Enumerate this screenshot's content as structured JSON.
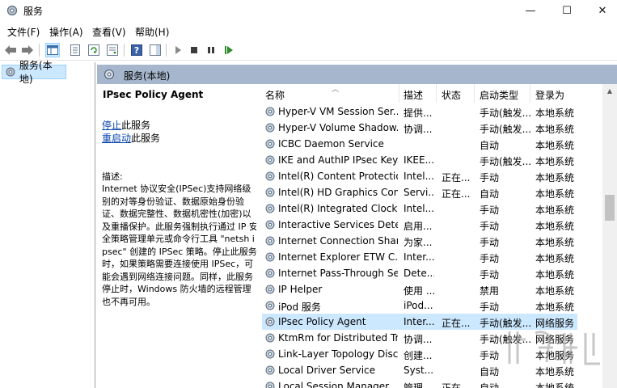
{
  "window": {
    "title": "服务",
    "minimize": "—",
    "maximize": "☐",
    "close": "✕"
  },
  "menu": [
    {
      "label": "文件(F)"
    },
    {
      "label": "操作(A)"
    },
    {
      "label": "查看(V)"
    },
    {
      "label": "帮助(H)"
    }
  ],
  "toolbar": {
    "icons": [
      "back-arrow-icon",
      "forward-arrow-icon",
      "console-tree-icon",
      "properties-icon",
      "refresh-icon",
      "export-list-icon",
      "help-icon",
      "show-hide-pane-icon",
      "play-icon",
      "stop-icon",
      "pause-icon",
      "restart-icon"
    ]
  },
  "tree": {
    "item_label": "服务(本地)"
  },
  "pane": {
    "header_label": "服务(本地)"
  },
  "description": {
    "service_name": "IPsec Policy Agent",
    "stop_link": "停止",
    "stop_suffix": "此服务",
    "restart_link": "重启动",
    "restart_suffix": "此服务",
    "desc_label": "描述:",
    "desc_body": "Internet 协议安全(IPSec)支持网络级别的对等身份验证、数据原始身份验证、数据完整性、数据机密性(加密)以及重播保护。此服务强制执行通过 IP 安全策略管理单元或命令行工具 \"netsh ipsec\" 创建的 IPSec 策略。停止此服务时，如果策略需要连接使用 IPSec，可能会遇到网络连接问题。同样，此服务停止时，Windows 防火墙的远程管理也不再可用。"
  },
  "table": {
    "columns": [
      "名称",
      "描述",
      "状态",
      "启动类型",
      "登录为"
    ],
    "rows": [
      {
        "name": "Hyper-V VM Session Ser...",
        "desc": "提供...",
        "status": "",
        "startup": "手动(触发...",
        "logon": "本地系统"
      },
      {
        "name": "Hyper-V Volume Shadow...",
        "desc": "协调...",
        "status": "",
        "startup": "手动(触发...",
        "logon": "本地系统"
      },
      {
        "name": "ICBC Daemon Service",
        "desc": "",
        "status": "",
        "startup": "自动",
        "logon": "本地系统"
      },
      {
        "name": "IKE and AuthIP IPsec Key...",
        "desc": "IKEE...",
        "status": "",
        "startup": "手动(触发...",
        "logon": "本地系统"
      },
      {
        "name": "Intel(R) Content Protectio...",
        "desc": "Intel...",
        "status": "正在...",
        "startup": "手动",
        "logon": "本地系统"
      },
      {
        "name": "Intel(R) HD Graphics Con...",
        "desc": "Servi...",
        "status": "正在...",
        "startup": "自动",
        "logon": "本地系统"
      },
      {
        "name": "Intel(R) Integrated Clock ...",
        "desc": "Intel...",
        "status": "",
        "startup": "手动",
        "logon": "本地系统"
      },
      {
        "name": "Interactive Services Dete...",
        "desc": "启用...",
        "status": "",
        "startup": "手动",
        "logon": "本地系统"
      },
      {
        "name": "Internet Connection Shari...",
        "desc": "为家...",
        "status": "",
        "startup": "手动",
        "logon": "本地系统"
      },
      {
        "name": "Internet Explorer ETW C...",
        "desc": "Inter...",
        "status": "",
        "startup": "手动",
        "logon": "本地系统"
      },
      {
        "name": "Internet Pass-Through Se...",
        "desc": "Dete...",
        "status": "",
        "startup": "手动",
        "logon": "本地系统"
      },
      {
        "name": "IP Helper",
        "desc": "使用 ...",
        "status": "",
        "startup": "禁用",
        "logon": "本地系统"
      },
      {
        "name": "iPod 服务",
        "desc": "iPod...",
        "status": "",
        "startup": "手动",
        "logon": "本地系统"
      },
      {
        "name": "IPsec Policy Agent",
        "desc": "Inter...",
        "status": "正在...",
        "startup": "手动(触发...",
        "logon": "网络服务",
        "selected": true
      },
      {
        "name": "KtmRm for Distributed Tr...",
        "desc": "协调...",
        "status": "",
        "startup": "手动(触发...",
        "logon": "网络服务"
      },
      {
        "name": "Link-Layer Topology Disc...",
        "desc": "创建...",
        "status": "",
        "startup": "手动",
        "logon": "本地服务"
      },
      {
        "name": "Local Driver Service",
        "desc": "Syst...",
        "status": "",
        "startup": "自动",
        "logon": "本地系统"
      },
      {
        "name": "Local Session Manager",
        "desc": "管理...",
        "status": "正在...",
        "startup": "自动",
        "logon": "本地系统"
      }
    ]
  },
  "colors": {
    "selection": "#cce8ff",
    "header_band": "#a6b7cd",
    "link": "#0645ad"
  }
}
